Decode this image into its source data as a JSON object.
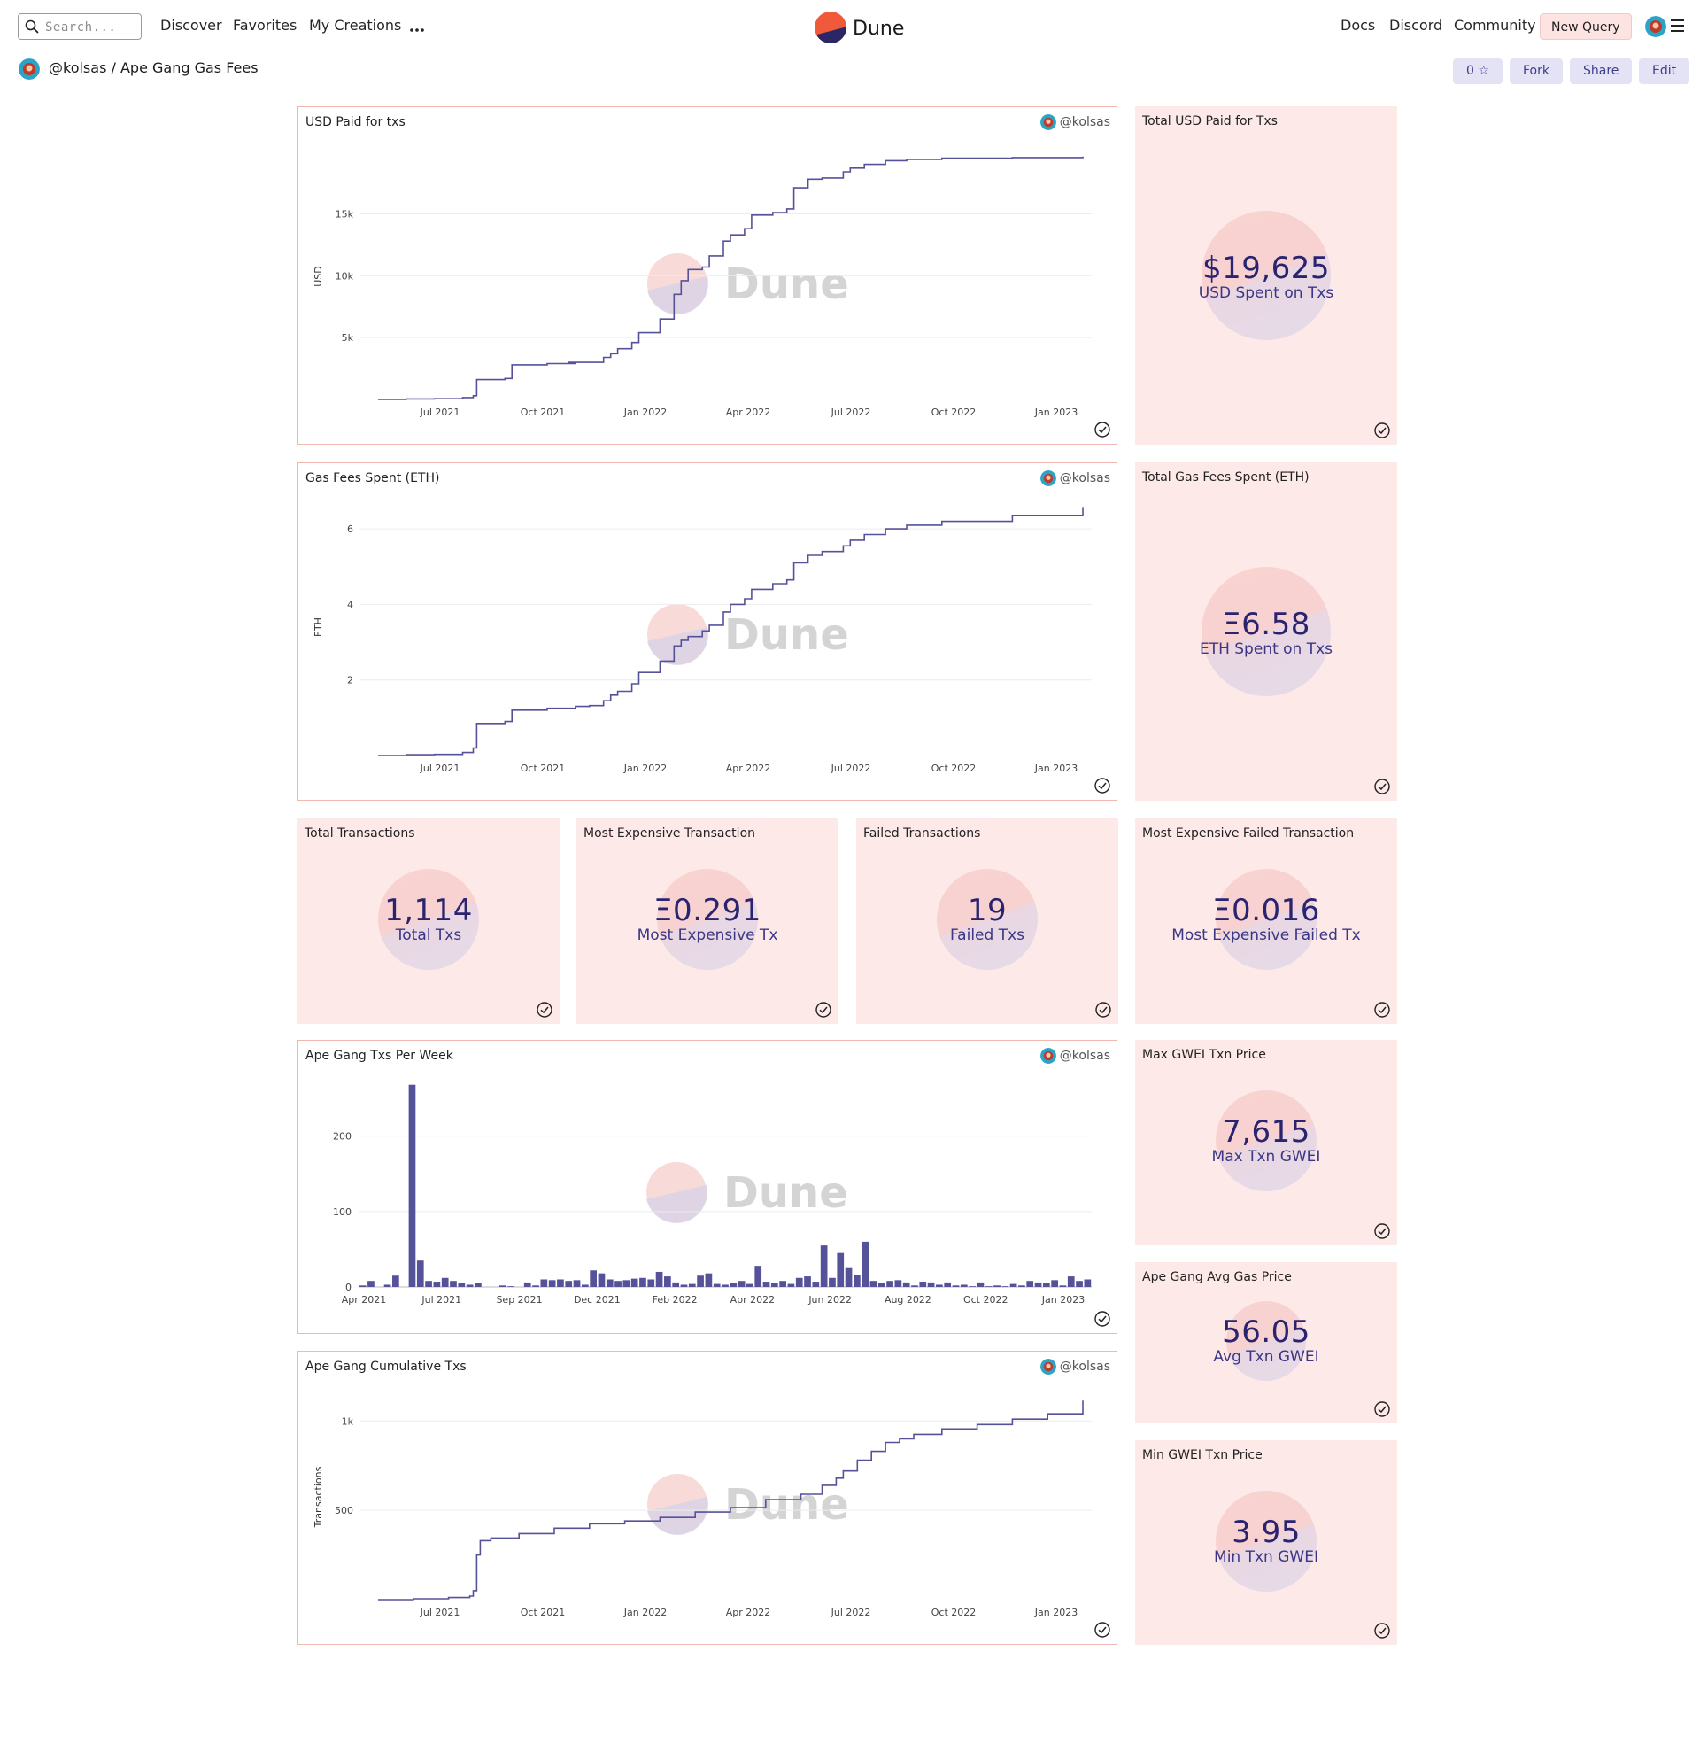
{
  "header": {
    "search_placeholder": "Search...",
    "nav": [
      "Discover",
      "Favorites",
      "My Creations"
    ],
    "more_icon": "more-horizontal-icon",
    "brand": "Dune",
    "right_links": [
      "Docs",
      "Discord",
      "Community"
    ],
    "new_query": "New Query"
  },
  "breadcrumb": {
    "text": "@kolsas / Ape Gang Gas Fees"
  },
  "actions": {
    "stars": "0 ☆",
    "fork": "Fork",
    "share": "Share",
    "edit": "Edit"
  },
  "colors": {
    "accent": "#56529a",
    "card_bg": "#fde9e7",
    "card_border": "#f2b6b0",
    "button_bg": "#e4e3f5"
  },
  "watermark": "Dune",
  "owner": "@kolsas",
  "charts": {
    "usd_paid": {
      "title": "USD Paid for txs",
      "chart_data": {
        "type": "line",
        "ylabel": "USD",
        "xlabel": "",
        "x_tick_labels": [
          "Jul 2021",
          "Oct 2021",
          "Jan 2022",
          "Apr 2022",
          "Jul 2022",
          "Oct 2022",
          "Jan 2023"
        ],
        "y_tick_labels": [
          "5k",
          "10k",
          "15k"
        ],
        "y_ticks": [
          5000,
          10000,
          15000
        ],
        "ylim": [
          0,
          19900
        ],
        "x": [
          0,
          0.04,
          0.08,
          0.12,
          0.135,
          0.14,
          0.18,
          0.19,
          0.24,
          0.28,
          0.27,
          0.3,
          0.32,
          0.33,
          0.34,
          0.36,
          0.37,
          0.4,
          0.42,
          0.43,
          0.44,
          0.46,
          0.47,
          0.49,
          0.5,
          0.52,
          0.53,
          0.56,
          0.58,
          0.59,
          0.61,
          0.63,
          0.66,
          0.67,
          0.69,
          0.72,
          0.75,
          0.8,
          0.9,
          1.0
        ],
        "values": [
          0,
          40,
          60,
          150,
          300,
          1600,
          1700,
          2800,
          2900,
          3000,
          3000,
          3000,
          3400,
          3700,
          4100,
          4600,
          5400,
          6500,
          8500,
          9600,
          10500,
          10700,
          11600,
          12800,
          13300,
          13800,
          14900,
          15100,
          15400,
          17100,
          17800,
          17900,
          18400,
          18700,
          19000,
          19300,
          19400,
          19500,
          19550,
          19625
        ]
      }
    },
    "gas_fees": {
      "title": "Gas Fees Spent (ETH)",
      "chart_data": {
        "type": "line",
        "ylabel": "ETH",
        "xlabel": "",
        "x_tick_labels": [
          "Jul 2021",
          "Oct 2021",
          "Jan 2022",
          "Apr 2022",
          "Jul 2022",
          "Oct 2022",
          "Jan 2023"
        ],
        "y_tick_labels": [
          "2",
          "4",
          "6"
        ],
        "y_ticks": [
          2,
          4,
          6
        ],
        "ylim": [
          0,
          6.8
        ],
        "x": [
          0,
          0.04,
          0.08,
          0.12,
          0.135,
          0.14,
          0.18,
          0.19,
          0.24,
          0.28,
          0.3,
          0.32,
          0.33,
          0.34,
          0.36,
          0.37,
          0.4,
          0.42,
          0.43,
          0.44,
          0.46,
          0.47,
          0.49,
          0.5,
          0.52,
          0.53,
          0.56,
          0.58,
          0.59,
          0.61,
          0.63,
          0.66,
          0.67,
          0.69,
          0.72,
          0.75,
          0.8,
          0.9,
          1.0
        ],
        "values": [
          0,
          0.02,
          0.03,
          0.08,
          0.2,
          0.85,
          0.9,
          1.2,
          1.25,
          1.3,
          1.32,
          1.45,
          1.6,
          1.7,
          1.9,
          2.2,
          2.5,
          2.9,
          3.05,
          3.15,
          3.3,
          3.45,
          3.8,
          4.0,
          4.15,
          4.4,
          4.55,
          4.65,
          5.1,
          5.3,
          5.4,
          5.55,
          5.7,
          5.85,
          6.0,
          6.1,
          6.2,
          6.35,
          6.58
        ]
      }
    },
    "txs_per_week": {
      "title": "Ape Gang Txs Per Week",
      "chart_data": {
        "type": "bar",
        "xlabel": "",
        "ylabel": "",
        "x_tick_labels": [
          "Apr 2021",
          "Jul 2021",
          "Sep 2021",
          "Dec 2021",
          "Feb 2022",
          "Apr 2022",
          "Jun 2022",
          "Aug 2022",
          "Oct 2022",
          "Jan 2023"
        ],
        "y_tick_labels": [
          "0",
          "100",
          "200"
        ],
        "y_ticks": [
          0,
          100,
          200
        ],
        "ylim": [
          0,
          270
        ],
        "values": [
          2,
          8,
          0,
          3,
          15,
          0,
          268,
          35,
          8,
          7,
          12,
          8,
          5,
          3,
          5,
          0,
          0,
          2,
          1,
          0,
          6,
          2,
          10,
          9,
          10,
          8,
          9,
          3,
          22,
          18,
          10,
          8,
          9,
          11,
          12,
          10,
          20,
          14,
          6,
          3,
          4,
          15,
          18,
          4,
          3,
          5,
          8,
          4,
          28,
          7,
          5,
          8,
          4,
          12,
          14,
          7,
          55,
          12,
          45,
          25,
          16,
          60,
          8,
          5,
          8,
          9,
          6,
          2,
          7,
          6,
          3,
          6,
          2,
          3,
          1,
          6,
          1,
          2,
          1,
          4,
          2,
          8,
          6,
          5,
          9,
          2,
          14,
          8,
          10
        ]
      }
    },
    "cumulative": {
      "title": "Ape Gang Cumulative Txs",
      "chart_data": {
        "type": "line",
        "ylabel": "Transactions",
        "xlabel": "",
        "x_tick_labels": [
          "Jul 2021",
          "Oct 2021",
          "Jan 2022",
          "Apr 2022",
          "Jul 2022",
          "Oct 2022",
          "Jan 2023"
        ],
        "y_tick_labels": [
          "500",
          "1k"
        ],
        "y_ticks": [
          500,
          1000
        ],
        "ylim": [
          0,
          1150
        ],
        "x": [
          0,
          0.05,
          0.1,
          0.13,
          0.135,
          0.14,
          0.145,
          0.16,
          0.2,
          0.25,
          0.3,
          0.35,
          0.4,
          0.45,
          0.5,
          0.55,
          0.6,
          0.63,
          0.65,
          0.66,
          0.68,
          0.7,
          0.72,
          0.74,
          0.76,
          0.8,
          0.85,
          0.9,
          0.95,
          1.0
        ],
        "values": [
          0,
          5,
          12,
          20,
          50,
          250,
          330,
          345,
          370,
          400,
          425,
          440,
          460,
          490,
          515,
          560,
          590,
          640,
          680,
          720,
          780,
          830,
          880,
          900,
          925,
          955,
          980,
          1010,
          1040,
          1114
        ]
      }
    }
  },
  "counters": {
    "total_usd": {
      "title": "Total USD Paid for Txs",
      "value": "$19,625",
      "label": "USD Spent on Txs"
    },
    "total_gas": {
      "title": "Total Gas Fees Spent (ETH)",
      "value": "Ξ6.58",
      "label": "ETH Spent on Txs"
    },
    "total_tx": {
      "title": "Total Transactions",
      "value": "1,114",
      "label": "Total Txs"
    },
    "most_exp": {
      "title": "Most Expensive Transaction",
      "value": "Ξ0.291",
      "label": "Most Expensive Tx"
    },
    "failed": {
      "title": "Failed Transactions",
      "value": "19",
      "label": "Failed Txs"
    },
    "most_exp_failed": {
      "title": "Most Expensive Failed Transaction",
      "value": "Ξ0.016",
      "label": "Most Expensive Failed Tx"
    },
    "max_gwei": {
      "title": "Max GWEI Txn Price",
      "value": "7,615",
      "label": "Max Txn GWEI"
    },
    "avg_gas": {
      "title": "Ape Gang Avg Gas Price",
      "value": "56.05",
      "label": "Avg Txn GWEI"
    },
    "min_gwei": {
      "title": "Min GWEI Txn Price",
      "value": "3.95",
      "label": "Min Txn GWEI"
    }
  }
}
